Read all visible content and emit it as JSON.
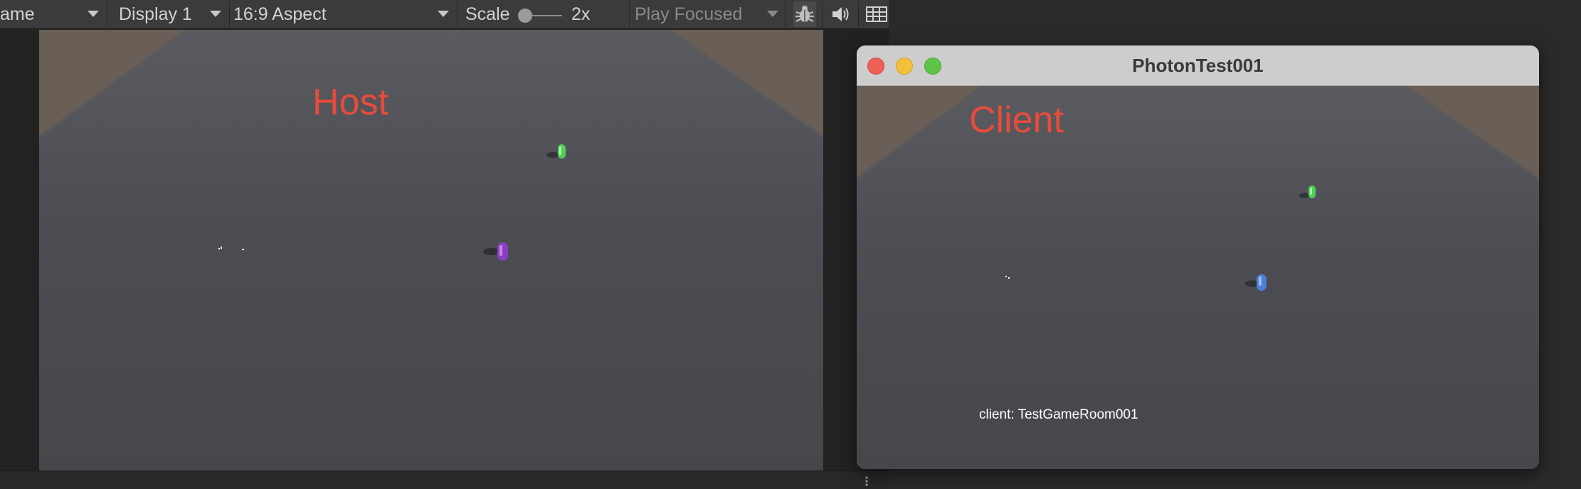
{
  "editor": {
    "toolbar": {
      "game_tab_label": "ame",
      "display_label": "Display 1",
      "aspect_label": "16:9 Aspect",
      "scale_label": "Scale",
      "scale_value": "2x",
      "play_mode_label": "Play Focused"
    },
    "icons": [
      "dropdown-caret-icon",
      "slider-knob-icon",
      "bug-icon",
      "speaker-icon",
      "stats-grid-icon",
      "more-vertical-icon"
    ],
    "host_view": {
      "role_label": "Host"
    }
  },
  "build_window": {
    "title": "PhotonTest001",
    "client_view": {
      "role_label": "Client",
      "room_text": "client: TestGameRoom001"
    }
  },
  "colors": {
    "role_label": "#e84b3c",
    "player_green": "#4fcf57",
    "player_purple": "#8a3ec0",
    "player_blue": "#4f7fd6",
    "floor": "#4d4e52",
    "wall": "#6b6056"
  }
}
